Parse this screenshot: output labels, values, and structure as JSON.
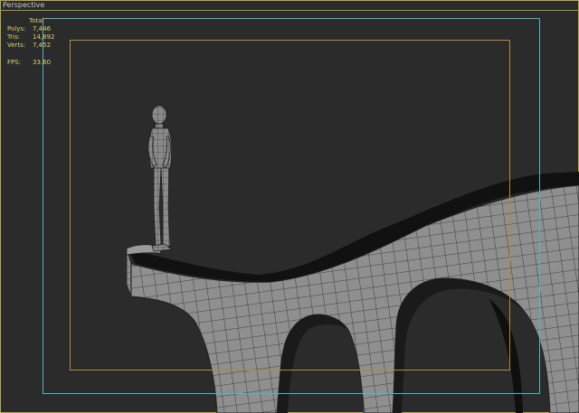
{
  "viewport": {
    "label": "Perspective"
  },
  "stats": {
    "header": "Total",
    "rows": [
      {
        "key": "Polys:",
        "value": "7,446"
      },
      {
        "key": "Tris:",
        "value": "14,892"
      },
      {
        "key": "Verts:",
        "value": "7,452"
      }
    ],
    "fps_key": "FPS:",
    "fps_value": "33.60"
  },
  "colors": {
    "background": "#2b2b2b",
    "safe_frame_outer": "#4fb7c3",
    "safe_frame_inner": "#b08a3a",
    "mesh_fill": "#8f8f8f",
    "wire": "#2a2a2a"
  }
}
